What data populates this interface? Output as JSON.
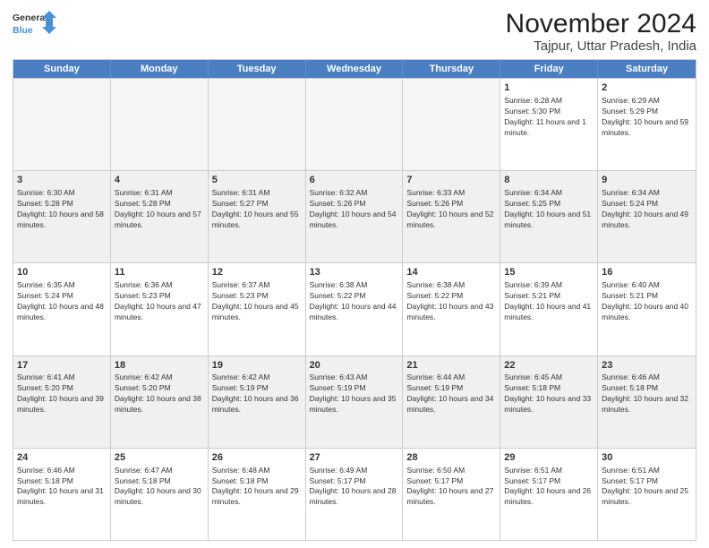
{
  "logo": {
    "line1": "General",
    "line2": "Blue"
  },
  "title": "November 2024",
  "location": "Tajpur, Uttar Pradesh, India",
  "weekdays": [
    "Sunday",
    "Monday",
    "Tuesday",
    "Wednesday",
    "Thursday",
    "Friday",
    "Saturday"
  ],
  "rows": [
    [
      {
        "day": "",
        "empty": true
      },
      {
        "day": "",
        "empty": true
      },
      {
        "day": "",
        "empty": true
      },
      {
        "day": "",
        "empty": true
      },
      {
        "day": "",
        "empty": true
      },
      {
        "day": "1",
        "sunrise": "6:28 AM",
        "sunset": "5:30 PM",
        "daylight": "11 hours and 1 minute."
      },
      {
        "day": "2",
        "sunrise": "6:29 AM",
        "sunset": "5:29 PM",
        "daylight": "10 hours and 59 minutes."
      }
    ],
    [
      {
        "day": "3",
        "sunrise": "6:30 AM",
        "sunset": "5:28 PM",
        "daylight": "10 hours and 58 minutes."
      },
      {
        "day": "4",
        "sunrise": "6:31 AM",
        "sunset": "5:28 PM",
        "daylight": "10 hours and 57 minutes."
      },
      {
        "day": "5",
        "sunrise": "6:31 AM",
        "sunset": "5:27 PM",
        "daylight": "10 hours and 55 minutes."
      },
      {
        "day": "6",
        "sunrise": "6:32 AM",
        "sunset": "5:26 PM",
        "daylight": "10 hours and 54 minutes."
      },
      {
        "day": "7",
        "sunrise": "6:33 AM",
        "sunset": "5:26 PM",
        "daylight": "10 hours and 52 minutes."
      },
      {
        "day": "8",
        "sunrise": "6:34 AM",
        "sunset": "5:25 PM",
        "daylight": "10 hours and 51 minutes."
      },
      {
        "day": "9",
        "sunrise": "6:34 AM",
        "sunset": "5:24 PM",
        "daylight": "10 hours and 49 minutes."
      }
    ],
    [
      {
        "day": "10",
        "sunrise": "6:35 AM",
        "sunset": "5:24 PM",
        "daylight": "10 hours and 48 minutes."
      },
      {
        "day": "11",
        "sunrise": "6:36 AM",
        "sunset": "5:23 PM",
        "daylight": "10 hours and 47 minutes."
      },
      {
        "day": "12",
        "sunrise": "6:37 AM",
        "sunset": "5:23 PM",
        "daylight": "10 hours and 45 minutes."
      },
      {
        "day": "13",
        "sunrise": "6:38 AM",
        "sunset": "5:22 PM",
        "daylight": "10 hours and 44 minutes."
      },
      {
        "day": "14",
        "sunrise": "6:38 AM",
        "sunset": "5:22 PM",
        "daylight": "10 hours and 43 minutes."
      },
      {
        "day": "15",
        "sunrise": "6:39 AM",
        "sunset": "5:21 PM",
        "daylight": "10 hours and 41 minutes."
      },
      {
        "day": "16",
        "sunrise": "6:40 AM",
        "sunset": "5:21 PM",
        "daylight": "10 hours and 40 minutes."
      }
    ],
    [
      {
        "day": "17",
        "sunrise": "6:41 AM",
        "sunset": "5:20 PM",
        "daylight": "10 hours and 39 minutes."
      },
      {
        "day": "18",
        "sunrise": "6:42 AM",
        "sunset": "5:20 PM",
        "daylight": "10 hours and 38 minutes."
      },
      {
        "day": "19",
        "sunrise": "6:42 AM",
        "sunset": "5:19 PM",
        "daylight": "10 hours and 36 minutes."
      },
      {
        "day": "20",
        "sunrise": "6:43 AM",
        "sunset": "5:19 PM",
        "daylight": "10 hours and 35 minutes."
      },
      {
        "day": "21",
        "sunrise": "6:44 AM",
        "sunset": "5:19 PM",
        "daylight": "10 hours and 34 minutes."
      },
      {
        "day": "22",
        "sunrise": "6:45 AM",
        "sunset": "5:18 PM",
        "daylight": "10 hours and 33 minutes."
      },
      {
        "day": "23",
        "sunrise": "6:46 AM",
        "sunset": "5:18 PM",
        "daylight": "10 hours and 32 minutes."
      }
    ],
    [
      {
        "day": "24",
        "sunrise": "6:46 AM",
        "sunset": "5:18 PM",
        "daylight": "10 hours and 31 minutes."
      },
      {
        "day": "25",
        "sunrise": "6:47 AM",
        "sunset": "5:18 PM",
        "daylight": "10 hours and 30 minutes."
      },
      {
        "day": "26",
        "sunrise": "6:48 AM",
        "sunset": "5:18 PM",
        "daylight": "10 hours and 29 minutes."
      },
      {
        "day": "27",
        "sunrise": "6:49 AM",
        "sunset": "5:17 PM",
        "daylight": "10 hours and 28 minutes."
      },
      {
        "day": "28",
        "sunrise": "6:50 AM",
        "sunset": "5:17 PM",
        "daylight": "10 hours and 27 minutes."
      },
      {
        "day": "29",
        "sunrise": "6:51 AM",
        "sunset": "5:17 PM",
        "daylight": "10 hours and 26 minutes."
      },
      {
        "day": "30",
        "sunrise": "6:51 AM",
        "sunset": "5:17 PM",
        "daylight": "10 hours and 25 minutes."
      }
    ]
  ]
}
